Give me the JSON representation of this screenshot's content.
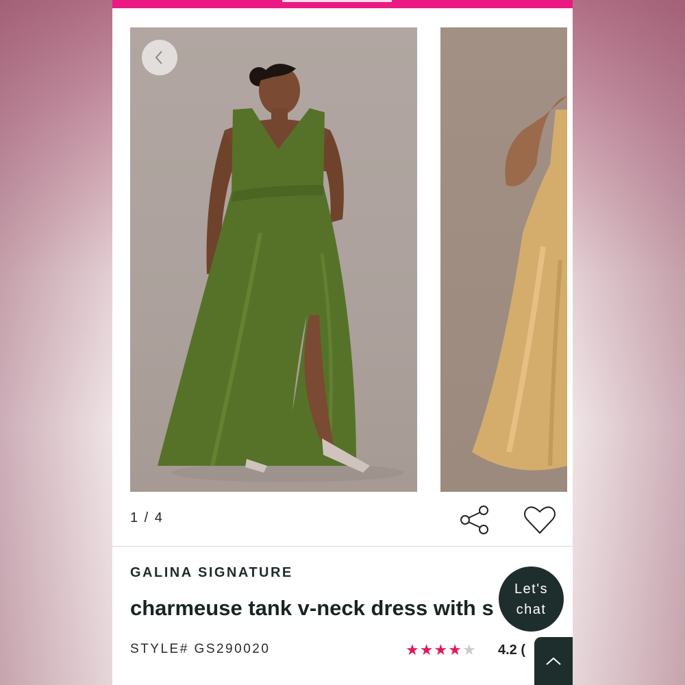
{
  "gallery": {
    "counter": "1 / 4",
    "images": [
      {
        "icon": "model-photo-green-dress",
        "dress_color": "#4f6b26"
      },
      {
        "icon": "model-photo-gold-dress",
        "dress_color": "#d4ac6c"
      }
    ]
  },
  "product": {
    "brand": "GALINA SIGNATURE",
    "title": "charmeuse tank v-neck dress with s",
    "style_number": "STYLE# GS290020",
    "rating": 4.2,
    "rating_text": "4.2 (",
    "star_count": 5,
    "filled_stars": 4
  },
  "chat": {
    "line1": "Let's",
    "line2": "chat"
  },
  "colors": {
    "brand_pink": "#ea1a82",
    "star_pink": "#e2185f",
    "chat_bg": "#1e2e2c"
  },
  "icons": [
    "chevron-left-icon",
    "share-icon",
    "heart-icon",
    "chevron-up-icon",
    "star-icon"
  ]
}
